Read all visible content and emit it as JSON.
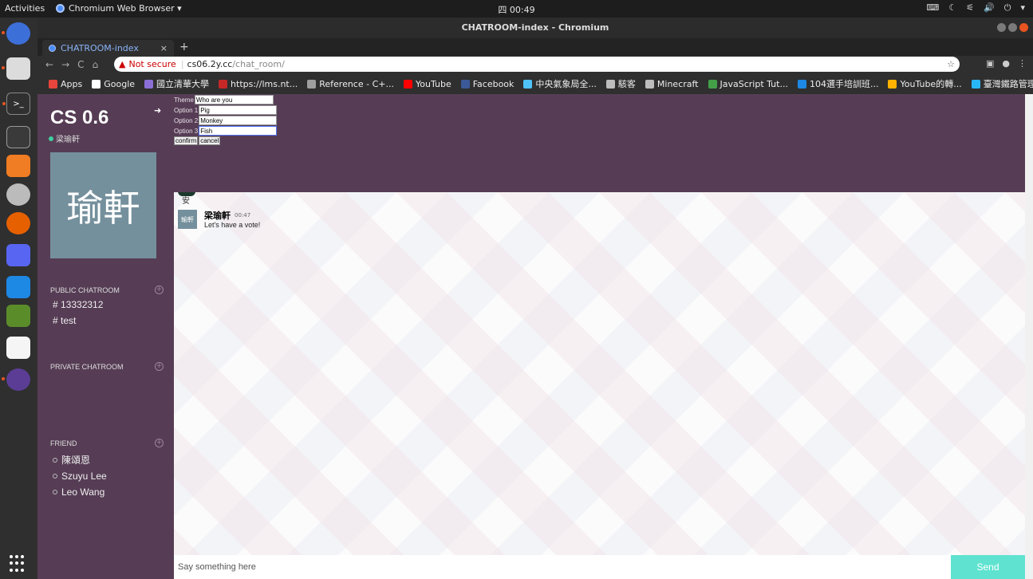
{
  "system": {
    "activities": "Activities",
    "app_menu": "Chromium Web Browser ▾",
    "clock": "四 00:49",
    "tray": [
      "⌨",
      "☾",
      "⚟",
      "🔊",
      "⏻",
      "▾"
    ]
  },
  "window": {
    "title": "CHATROOM-index - Chromium",
    "tab_title": "CHATROOM-index"
  },
  "browser": {
    "not_secure": "Not secure",
    "url_host": "cs06.2y.cc",
    "url_path": "/chat_room/"
  },
  "bookmarks": [
    {
      "label": "Apps",
      "color": "#e8453c"
    },
    {
      "label": "Google",
      "color": "#ffffff"
    },
    {
      "label": "國立清華大學",
      "color": "#8b6fd6"
    },
    {
      "label": "https://lms.nt...",
      "color": "#c62828"
    },
    {
      "label": "Reference - C+...",
      "color": "#9e9e9e"
    },
    {
      "label": "YouTube",
      "color": "#ff0000"
    },
    {
      "label": "Facebook",
      "color": "#3b5998"
    },
    {
      "label": "中央氣象局全...",
      "color": "#4fc3f7"
    },
    {
      "label": "駭客",
      "color": "#bdbdbd"
    },
    {
      "label": "Minecraft",
      "color": "#bdbdbd"
    },
    {
      "label": "JavaScript Tut...",
      "color": "#43a047"
    },
    {
      "label": "104選手培訓班...",
      "color": "#1e88e5"
    },
    {
      "label": "YouTube的轉...",
      "color": "#ffb300"
    },
    {
      "label": "臺灣鐵路管理...",
      "color": "#29b6f6"
    }
  ],
  "sidebar": {
    "brand": "CS 0.6",
    "username": "梁瑜軒",
    "avatar_text": "瑜軒",
    "public_title": "PUBLIC CHATROOM",
    "public_rooms": [
      "# 13332312",
      "# test"
    ],
    "private_title": "PRIVATE CHATROOM",
    "friend_title": "FRIEND",
    "friends": [
      "陳頌恩",
      "Szuyu Lee",
      "Leo Wang"
    ]
  },
  "vote": {
    "theme_label": "Theme",
    "theme_value": "Who are you",
    "option1_label": "Option 1",
    "option1_value": "Pig",
    "option2_label": "Option 2",
    "option2_value": "Monkey",
    "option3_label": "Option 3",
    "option3_value": "Fish",
    "confirm": "confirm",
    "cancel": "cancel"
  },
  "messages": {
    "partial_text": "安",
    "author": "梁瑜軒",
    "time": "00:47",
    "text": "Let's have a vote!",
    "avatar_text": "瑜軒"
  },
  "composer": {
    "placeholder": "Say something here",
    "send": "Send"
  },
  "colors": {
    "sidebar": "#563d55",
    "send": "#5fe3d0",
    "avatar": "#75909d"
  }
}
